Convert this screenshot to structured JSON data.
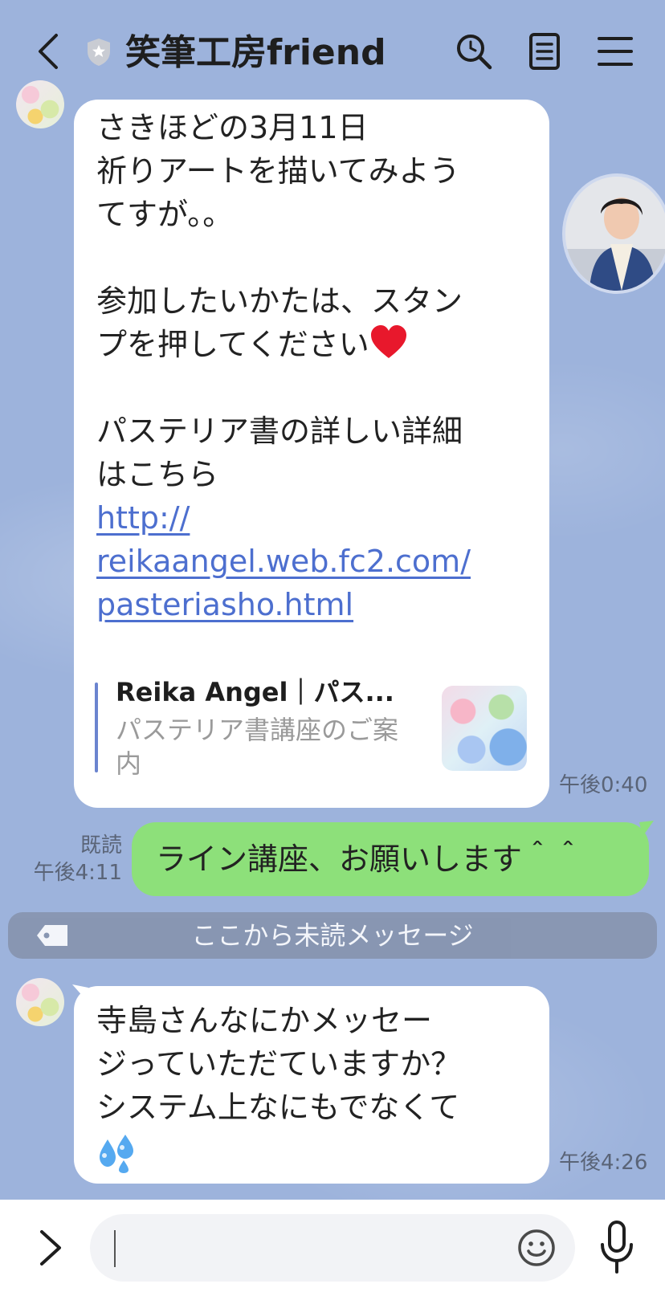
{
  "header": {
    "title": "笑筆工房friend",
    "icons": [
      "chevron-left-icon",
      "shield-star-icon",
      "search-icon",
      "notes-icon",
      "menu-icon"
    ]
  },
  "messages": {
    "incoming_1": {
      "lines": [
        "さきほどの3月11日",
        "祈りアートを描いてみよう",
        "てすが。。",
        "",
        "参加したいかたは、スタン",
        "プを押してください",
        "",
        "パステリア書の詳しい詳細",
        "はこちら"
      ],
      "emoji": "heart-emoji",
      "link_lines": [
        "http://",
        "reikaangel.web.fc2.com/",
        "pasteriasho.html"
      ],
      "preview": {
        "title": "Reika Angel｜パス...",
        "description": "パステリア書講座のご案内"
      },
      "time": "午後0:40"
    },
    "outgoing_1": {
      "text": "ライン講座、お願いします＾＾",
      "read_label": "既読",
      "time": "午後4:11"
    },
    "unread_divider": "ここから未読メッセージ",
    "incoming_2": {
      "lines": [
        "寺島さんなにかメッセー",
        "ジっていただていますか？",
        "システム上なにもでなくて"
      ],
      "emoji": "sweat-droplets-emoji",
      "time": "午後4:26"
    }
  },
  "input": {
    "placeholder": ""
  },
  "colors": {
    "background": "#9db3dc",
    "outgoing_bubble": "#8de07a",
    "incoming_bubble": "#ffffff",
    "link": "#4d6fcf"
  }
}
